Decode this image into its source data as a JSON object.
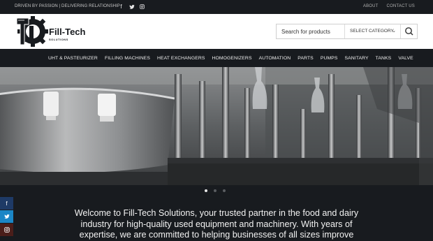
{
  "topbar": {
    "tagline": "DRIVEN BY PASSION | DELIVERING RELATIONSHIP",
    "socials": [
      "facebook-icon",
      "twitter-icon",
      "instagram-icon"
    ],
    "links": [
      "ABOUT",
      "CONTACT US"
    ]
  },
  "header": {
    "logo_text": "Fill-Tech",
    "logo_subtext": "SOLUTIONS",
    "search": {
      "placeholder": "Search for products",
      "category_label": "SELECT CATEGORY"
    }
  },
  "nav": {
    "items": [
      "UHT & PASTEURIZER",
      "FILLING MACHINES",
      "HEAT EXCHANGERS",
      "HOMOGENIZERS",
      "AUTOMATION",
      "PARTS",
      "PUMPS",
      "SANITARY",
      "TANKS",
      "VALVE"
    ]
  },
  "slider": {
    "slide_count": 3,
    "active_slide": 1
  },
  "welcome": {
    "lines": [
      "Welcome to Fill-Tech Solutions, your trusted partner in the food and dairy",
      "industry for high-quality used equipment and machinery. With years of",
      "expertise, we are committed to helping businesses of all sizes improve"
    ]
  },
  "colors": {
    "dark": "#181b1f",
    "facebook": "#1e3a66",
    "twitter": "#1b86c6",
    "instagram": "#4a1e1a"
  }
}
